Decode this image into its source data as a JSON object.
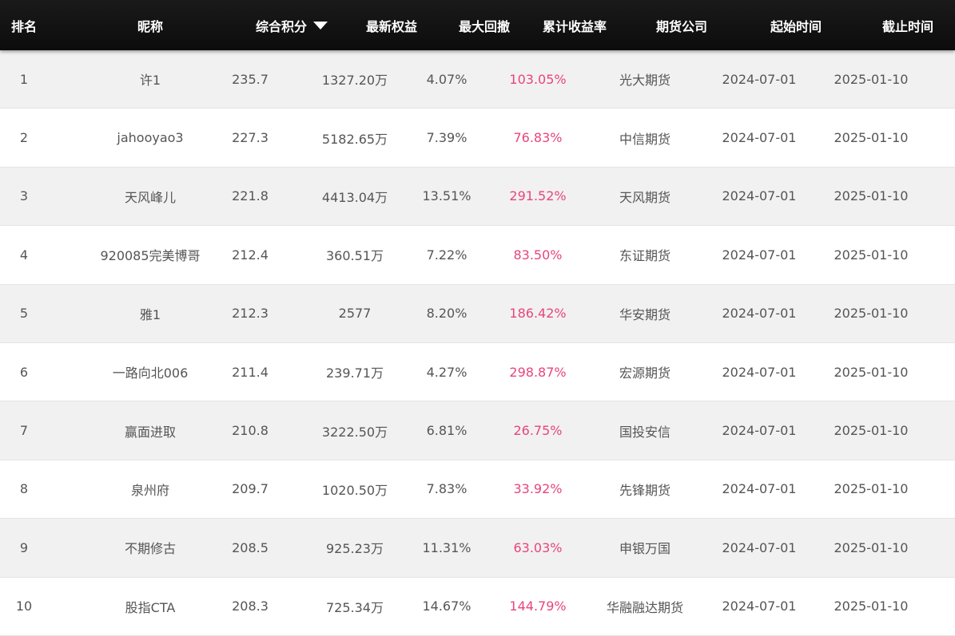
{
  "header": {
    "rank": "排名",
    "nickname": "昵称",
    "score": "综合积分",
    "equity": "最新权益",
    "drawdown": "最大回撤",
    "return": "累计收益率",
    "broker": "期货公司",
    "start": "起始时间",
    "end": "截止时间",
    "sort_icon": "caret-down-icon"
  },
  "colors": {
    "header_bg": "#111111",
    "return_color": "#e8457a",
    "row_alt": "#f1f1f1"
  },
  "rows": [
    {
      "rank": "1",
      "nickname": "许1",
      "score": "235.7",
      "equity": "1327.20万",
      "drawdown": "4.07%",
      "return": "103.05%",
      "broker": "光大期货",
      "start": "2024-07-01",
      "end": "2025-01-10"
    },
    {
      "rank": "2",
      "nickname": "jahooyao3",
      "score": "227.3",
      "equity": "5182.65万",
      "drawdown": "7.39%",
      "return": "76.83%",
      "broker": "中信期货",
      "start": "2024-07-01",
      "end": "2025-01-10"
    },
    {
      "rank": "3",
      "nickname": "天风峰儿",
      "score": "221.8",
      "equity": "4413.04万",
      "drawdown": "13.51%",
      "return": "291.52%",
      "broker": "天风期货",
      "start": "2024-07-01",
      "end": "2025-01-10"
    },
    {
      "rank": "4",
      "nickname": "920085完美博哥",
      "score": "212.4",
      "equity": "360.51万",
      "drawdown": "7.22%",
      "return": "83.50%",
      "broker": "东证期货",
      "start": "2024-07-01",
      "end": "2025-01-10"
    },
    {
      "rank": "5",
      "nickname": "雅1",
      "score": "212.3",
      "equity": "2577",
      "drawdown": "8.20%",
      "return": "186.42%",
      "broker": "华安期货",
      "start": "2024-07-01",
      "end": "2025-01-10"
    },
    {
      "rank": "6",
      "nickname": "一路向北006",
      "score": "211.4",
      "equity": "239.71万",
      "drawdown": "4.27%",
      "return": "298.87%",
      "broker": "宏源期货",
      "start": "2024-07-01",
      "end": "2025-01-10"
    },
    {
      "rank": "7",
      "nickname": "赢面进取",
      "score": "210.8",
      "equity": "3222.50万",
      "drawdown": "6.81%",
      "return": "26.75%",
      "broker": "国投安信",
      "start": "2024-07-01",
      "end": "2025-01-10"
    },
    {
      "rank": "8",
      "nickname": "泉州府",
      "score": "209.7",
      "equity": "1020.50万",
      "drawdown": "7.83%",
      "return": "33.92%",
      "broker": "先锋期货",
      "start": "2024-07-01",
      "end": "2025-01-10"
    },
    {
      "rank": "9",
      "nickname": "不期修古",
      "score": "208.5",
      "equity": "925.23万",
      "drawdown": "11.31%",
      "return": "63.03%",
      "broker": "申银万国",
      "start": "2024-07-01",
      "end": "2025-01-10"
    },
    {
      "rank": "10",
      "nickname": "股指CTA",
      "score": "208.3",
      "equity": "725.34万",
      "drawdown": "14.67%",
      "return": "144.79%",
      "broker": "华融融达期货",
      "start": "2024-07-01",
      "end": "2025-01-10"
    }
  ]
}
